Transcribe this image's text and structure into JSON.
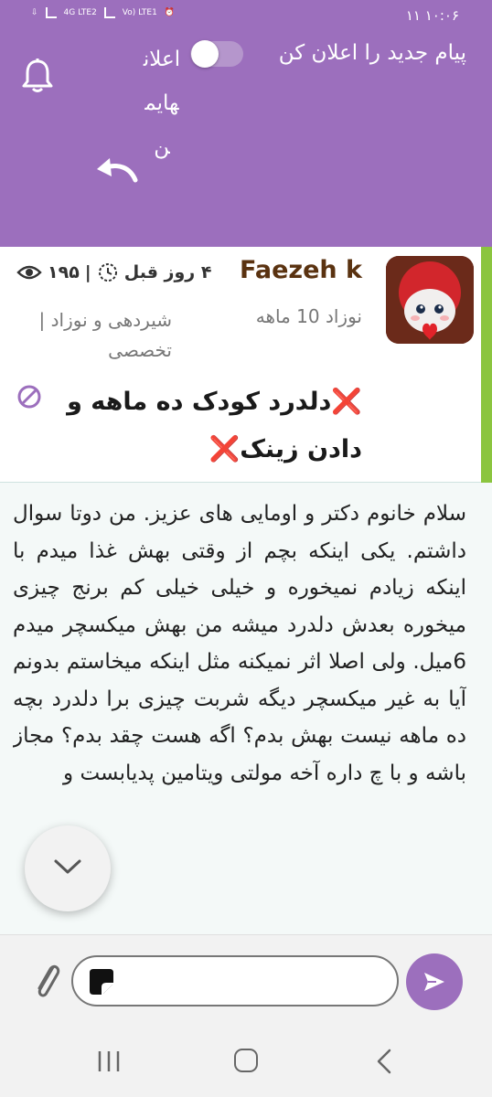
{
  "status_bar": {
    "time": "۱۰:۰۶",
    "date": "۱۱",
    "network_1": "4G LTE2",
    "network_2": "Vo) LTE1"
  },
  "header": {
    "notify_label": "پیام جدید را اعلان کن",
    "notify_enabled": false,
    "my_ads_label": "اعلانهایمن",
    "bell_icon": "bell-icon",
    "back_icon": "undo-arrow-icon"
  },
  "post": {
    "author": "Faezeh k",
    "group": "نوزاد 10 ماهه",
    "category": "شیردهی و نوزاد | تخصصی",
    "time_ago": "۴ روز قبل",
    "views": "۱۹۵",
    "title_text": "دلدرد کودک ده ماهه و دادن زینک",
    "title_emoji": "❌"
  },
  "body": {
    "text": "سلام خانوم دکتر و اومایی های عزیز. من دوتا سوال داشتم. یکی اینکه بچم از وقتی بهش غذا میدم با اینکه زیادم نمیخوره و خیلی خیلی کم برنج چیزی میخوره بعدش دلدرد میشه من بهش میکسچر میدم 6میل. ولی اصلا اثر نمیکنه مثل اینکه میخاستم بدونم آیا به غیر میکسچر دیگه شربت چیزی برا دلدرد بچه ده ماهه نیست بهش بدم؟ اگه هست چقد بدم؟ مجاز باشه و با چ داره آخه مولتی ویتامین پدیابست و"
  },
  "input": {
    "placeholder": "",
    "value": ""
  },
  "colors": {
    "primary": "#9c6fbd",
    "accent_bar": "#8bc53f",
    "author": "#5a3210",
    "emoji_red": "#d8232a"
  }
}
